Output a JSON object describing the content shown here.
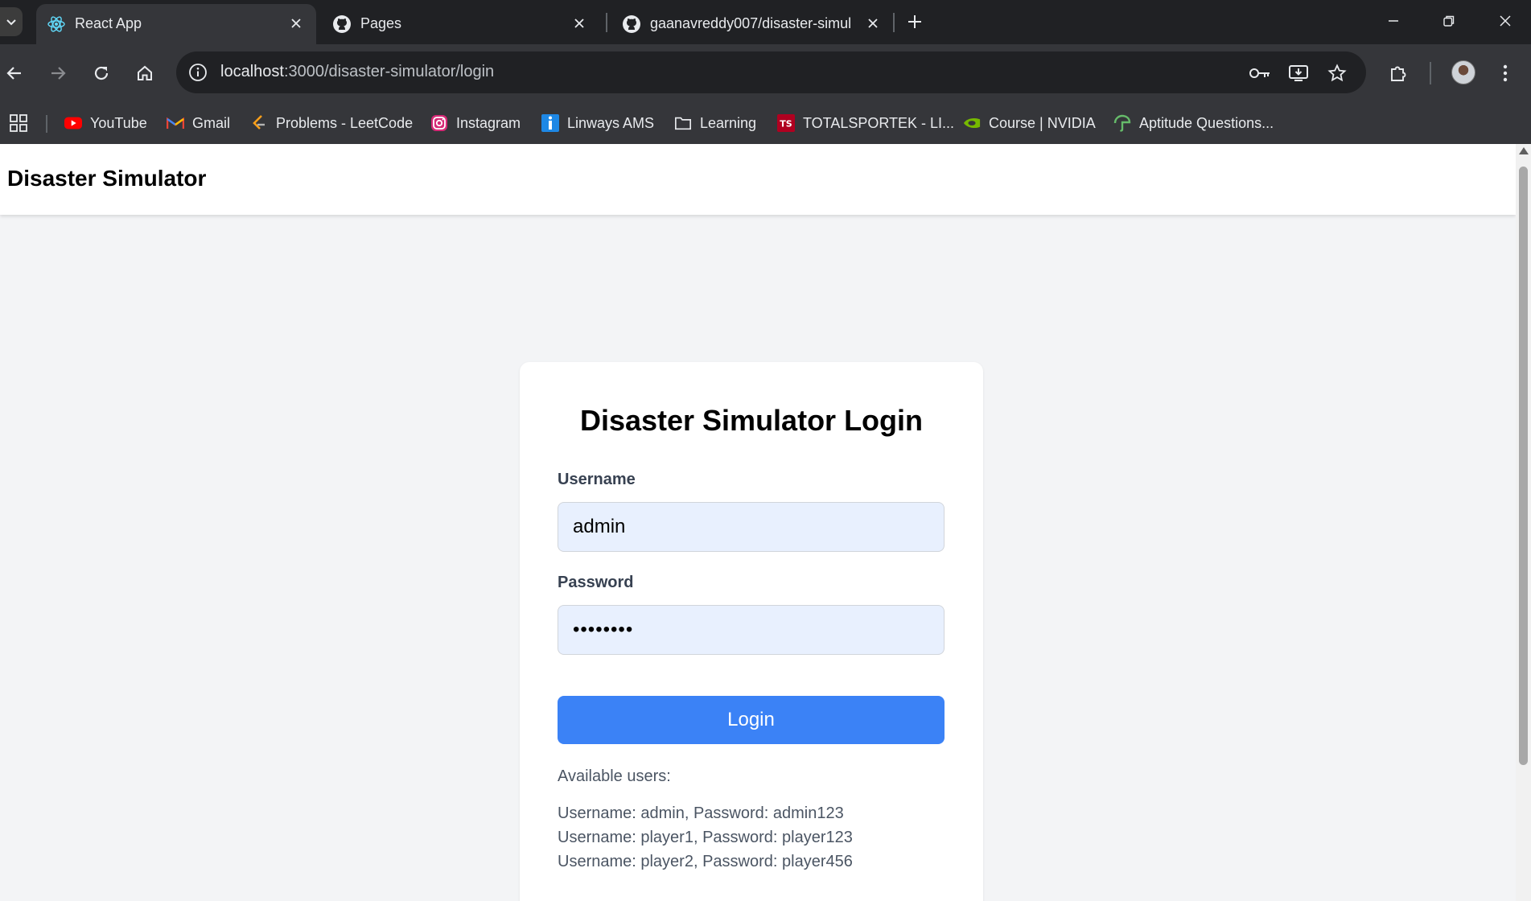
{
  "browser": {
    "tabs": [
      {
        "title": "React App",
        "active": true,
        "icon": "react-icon"
      },
      {
        "title": "Pages",
        "active": false,
        "icon": "github-icon"
      },
      {
        "title": "gaanavreddy007/disaster-simul",
        "active": false,
        "icon": "github-icon"
      }
    ],
    "url": {
      "host": "localhost",
      "path": ":3000/disaster-simulator/login"
    },
    "bookmarks": [
      {
        "label": "YouTube",
        "icon": "youtube-icon",
        "color": "#ff0000"
      },
      {
        "label": "Gmail",
        "icon": "gmail-icon",
        "color": "#ea4335"
      },
      {
        "label": "Problems - LeetCode",
        "icon": "leetcode-icon",
        "color": "#f89f1b"
      },
      {
        "label": "Instagram",
        "icon": "instagram-icon",
        "color": "#e1306c"
      },
      {
        "label": "Linways AMS",
        "icon": "linways-icon",
        "color": "#1e88e5"
      },
      {
        "label": "Learning",
        "icon": "folder-icon",
        "color": "#e8eaed"
      },
      {
        "label": "TOTALSPORTEK - LI...",
        "icon": "totalsportek-icon",
        "color": "#b00020"
      },
      {
        "label": "Course | NVIDIA",
        "icon": "nvidia-icon",
        "color": "#76b900"
      },
      {
        "label": "Aptitude Questions...",
        "icon": "aptitude-icon",
        "color": "#4caf50"
      }
    ]
  },
  "app": {
    "header_title": "Disaster Simulator",
    "login": {
      "title": "Disaster Simulator Login",
      "username_label": "Username",
      "username_value": "admin",
      "password_label": "Password",
      "password_value": "••••••••",
      "button_label": "Login",
      "users_heading": "Available users:",
      "users": [
        "Username: admin, Password: admin123",
        "Username: player1, Password: player123",
        "Username: player2, Password: player456"
      ]
    },
    "colors": {
      "accent": "#3b82f6",
      "input_bg": "#e8f0fe",
      "page_bg": "#f3f4f6"
    }
  }
}
